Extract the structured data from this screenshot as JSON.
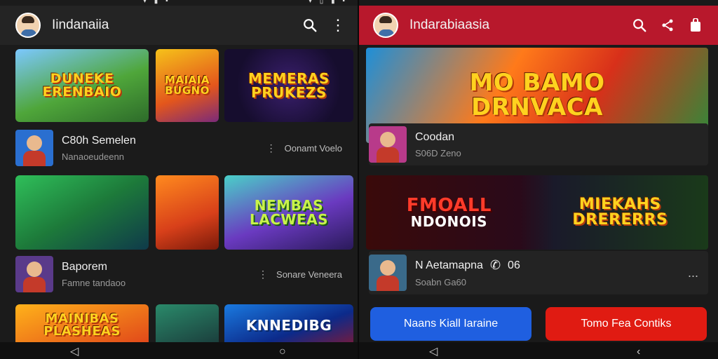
{
  "status": {
    "icons": "▾ ▮ ▪",
    "icons_right": "▾ ▯ ▮ ▪"
  },
  "left": {
    "title": "Iindanaiia",
    "tiles": [
      {
        "text": "DUNEKE ERENBAIO"
      },
      {
        "text": "MAIAIA BUGNO"
      },
      {
        "text": "MEMERAS PRUKEZS"
      },
      {
        "text": ""
      },
      {
        "text": ""
      },
      {
        "text": "NEMBAS LACWEAS"
      },
      {
        "text": "MAINIBAS PLASHEAS"
      },
      {
        "text": ""
      },
      {
        "text": "KNNEDIBG"
      }
    ],
    "rows": [
      {
        "title": "C80h Semelen",
        "sub": "Nanaoeudeenn",
        "meta": "Oonamt Voelo"
      },
      {
        "title": "Baporem",
        "sub": "Famne tandaoo",
        "meta": "Sonare Veneera"
      }
    ],
    "menu_icon": "⋮"
  },
  "right": {
    "title": "Indarabiaasia",
    "hero": {
      "line1": "MO BAMO",
      "line2": "DRNVACA"
    },
    "rows": [
      {
        "title": "Coodan",
        "sub": "S06D Zeno",
        "meta": ""
      },
      {
        "title": "N Aetamapna",
        "sub": "Soabn Ga60",
        "meta": "06",
        "phone_icon": "✆",
        "dots": "..."
      }
    ],
    "banner": {
      "left_line1": "FMOALL",
      "left_line2": "NDONOIS",
      "right_line1": "MIEKAHS",
      "right_line2": "DRERERRS"
    },
    "buttons": {
      "primary": "Naans Kiall Iaraine",
      "secondary": "Tomo Fea Contiks"
    }
  },
  "nav": {
    "back": "◁",
    "home": "○",
    "recent": "‹"
  },
  "colors": {
    "header_left": "#242424",
    "header_right": "#b8182c",
    "btn_primary": "#1f5fe0",
    "btn_secondary": "#e01b12"
  }
}
